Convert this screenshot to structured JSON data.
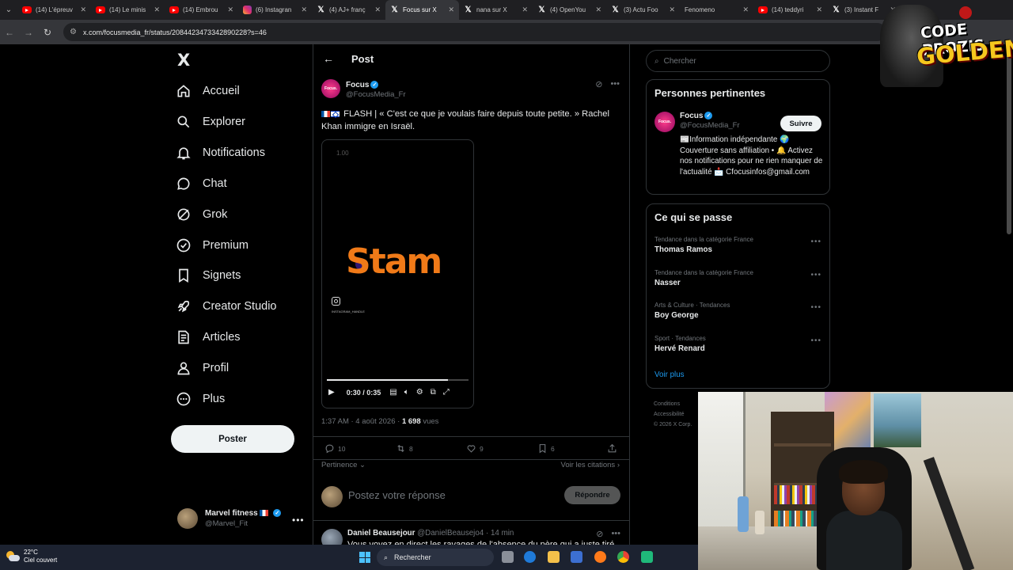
{
  "browser": {
    "tabs": [
      {
        "favicon": "youtube-icon",
        "title": "(14) L'épreuv"
      },
      {
        "favicon": "youtube-icon",
        "title": "(14) Le minis"
      },
      {
        "favicon": "youtube-icon",
        "title": "(14) Embrou"
      },
      {
        "favicon": "instagram-icon",
        "title": "(6) Instagran"
      },
      {
        "favicon": "x-icon",
        "title": "(4) AJ+ franç"
      },
      {
        "favicon": "x-icon",
        "title": "Focus sur X",
        "active": true
      },
      {
        "favicon": "x-icon",
        "title": "nana sur X"
      },
      {
        "favicon": "x-icon",
        "title": "(4) OpenYou"
      },
      {
        "favicon": "x-icon",
        "title": "(3) Actu Foo"
      },
      {
        "favicon": "none",
        "title": "Fenomeno"
      },
      {
        "favicon": "youtube-icon",
        "title": "(14) teddyri"
      },
      {
        "favicon": "x-icon",
        "title": "(3) Instant F"
      }
    ],
    "url": "x.com/focusmedia_fr/status/2084423473342890228?s=46"
  },
  "nav": {
    "logo": "X",
    "items": [
      {
        "label": "Accueil",
        "icon": "home-icon"
      },
      {
        "label": "Explorer",
        "icon": "search-icon"
      },
      {
        "label": "Notifications",
        "icon": "bell-icon"
      },
      {
        "label": "Chat",
        "icon": "chat-icon"
      },
      {
        "label": "Grok",
        "icon": "grok-icon"
      },
      {
        "label": "Premium",
        "icon": "premium-icon"
      },
      {
        "label": "Signets",
        "icon": "bookmark-icon"
      },
      {
        "label": "Creator Studio",
        "icon": "rocket-icon"
      },
      {
        "label": "Articles",
        "icon": "article-icon"
      },
      {
        "label": "Profil",
        "icon": "person-icon"
      },
      {
        "label": "Plus",
        "icon": "more-circle-icon"
      }
    ],
    "post_button": "Poster",
    "account": {
      "name": "Marvel fitness",
      "handle": "@Marvel_Fit"
    }
  },
  "post": {
    "header_title": "Post",
    "author": {
      "name": "Focus",
      "handle": "@FocusMedia_Fr",
      "avatar_text": "Focus."
    },
    "text": "FLASH | « C'est ce que je voulais faire depuis toute petite. » Rachel Khan immigre en Israël.",
    "video": {
      "speed": "1.00",
      "brand": "Stam",
      "ig_handle": "INSTAGRAM_HANDLE",
      "time": "0:30 / 0:35",
      "progress": 0.857
    },
    "time": "1:37 AM · 4 août 2026",
    "views_count": "1 698",
    "views_label": "vues",
    "stats": {
      "replies": "10",
      "reposts": "8",
      "likes": "9",
      "bookmarks": "6"
    },
    "sort_label": "Pertinence",
    "quotes_label": "Voir les citations",
    "reply_placeholder": "Postez votre réponse",
    "reply_button": "Répondre"
  },
  "first_reply": {
    "name": "Daniel Beausejour",
    "handle": "@DanielBeausejo4",
    "time": "14 min",
    "text": "Vous voyez en direct les ravages de l'absence du père qui a juste tiré un"
  },
  "sidebar": {
    "search_placeholder": "Chercher",
    "relevant_title": "Personnes pertinentes",
    "relevant_user": {
      "name": "Focus",
      "handle": "@FocusMedia_Fr",
      "follow_label": "Suivre",
      "bio": "📰Information indépendante 🌍 Couverture sans affiliation • 🔔 Activez nos notifications pour ne rien manquer de l'actualité 📩 Cfocusinfos@gmail.com"
    },
    "trends_title": "Ce qui se passe",
    "trends": [
      {
        "context": "Tendance dans la catégorie France",
        "name": "Thomas Ramos"
      },
      {
        "context": "Tendance dans la catégorie France",
        "name": "Nasser"
      },
      {
        "context": "Arts & Culture · Tendances",
        "name": "Boy George"
      },
      {
        "context": "Sport · Tendances",
        "name": "Hervé Renard"
      }
    ],
    "see_more": "Voir plus",
    "footer": {
      "line1": "Conditions",
      "line2": "Accessibilité",
      "line3": "© 2026 X Corp."
    }
  },
  "overlay": {
    "line1": "CODE PROZIS",
    "line2": "GOLDENG"
  },
  "taskbar": {
    "temperature": "22°C",
    "weather": "Ciel couvert",
    "search_label": "Rechercher"
  },
  "colors": {
    "accent": "#1d9bf0",
    "background": "#000000",
    "border": "#2f3336",
    "muted": "#71767b"
  }
}
